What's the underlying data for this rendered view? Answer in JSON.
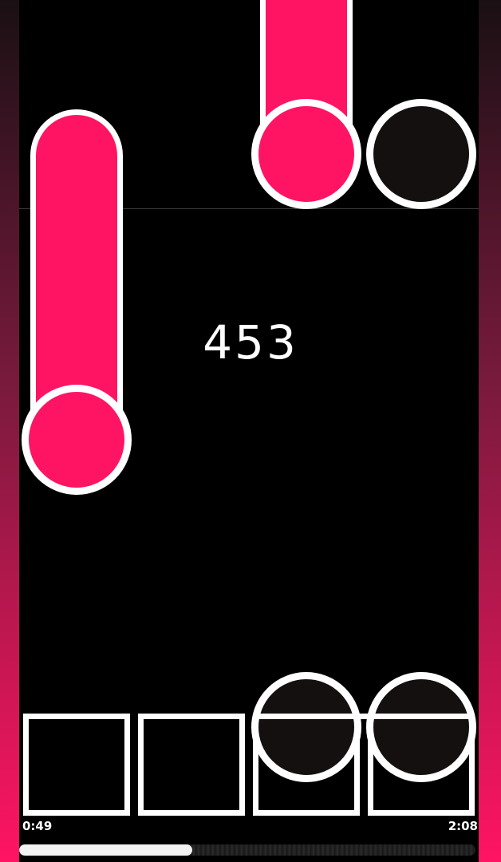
{
  "game": {
    "score": "453",
    "time_elapsed": "0:49",
    "time_total": "2:08",
    "progress": 0.38
  },
  "colors": {
    "note_pink": "#ff1463",
    "note_dark": "#141010",
    "outline": "#ffffff",
    "background": "#000000"
  },
  "icons": {
    "tap_key": "square-outline",
    "note": "circle"
  }
}
